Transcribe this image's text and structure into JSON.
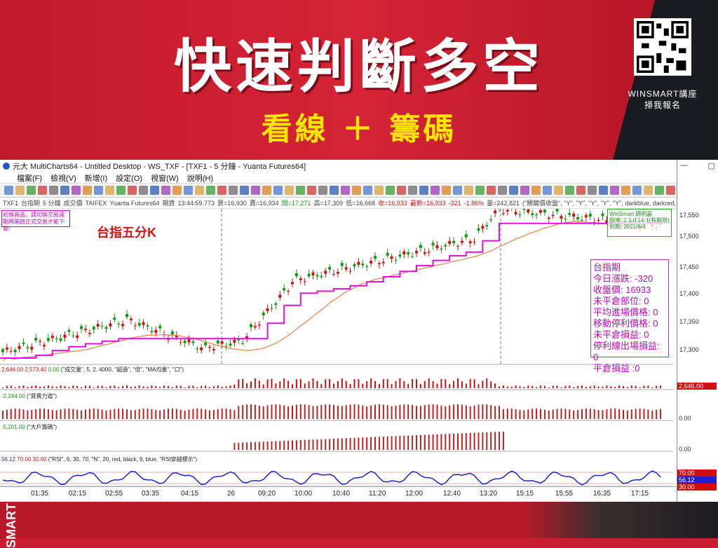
{
  "banner": {
    "title": "快速判斷多空",
    "subtitle": "看線 ＋ 籌碼",
    "qr_caption_1": "WINSMART講座",
    "qr_caption_2": "掃我報名"
  },
  "window": {
    "title": "元大 MultiCharts64 - Untitled Desktop - WS_TXF - [TXF1 - 5 分鐘 - Yuanta Futures64]",
    "controls": [
      "—",
      "▢",
      "✕"
    ]
  },
  "menu": [
    "檔案(F)",
    "檢視(V)",
    "新增(I)",
    "設定(O)",
    "視窗(W)",
    "說明(H)"
  ],
  "status": {
    "symbol": "TXF1",
    "name": "台指期",
    "interval": "5 分鐘",
    "field": "成交價",
    "exchange": "TAIFEX",
    "source": "Yuanta Futures64",
    "type": "期貨",
    "time": "13:44:59.773",
    "bid": "買=16,930",
    "ask": "賣=16,934",
    "open": "開=17,271",
    "high": "高=17,309",
    "low": "低=16,668",
    "close": "收=16,933",
    "last": "最新=16,933",
    "change": "-321",
    "change_pct": "-1.86%",
    "volume": "量=242,821",
    "indicator": "(\"關鍵價收盤\", \"Y\", \"Y\", \"Y\", \"Y\", \"Y\", darkblue, darkred, darkgreen,"
  },
  "chart": {
    "label": "台指五分K",
    "note": "初換商品，請切換交易週期再開啟正式交易才能下單!",
    "ws_line1": "WinSmart 聰明贏",
    "ws_line2": "版本: 1.1.0.14-1(有期限)",
    "ws_line3": "到期: 2021/6/4",
    "info": [
      "台指期",
      "今日漲跌: -320",
      "收盤價: 16933",
      "未平倉部位: 0",
      "平均進場價格: 0",
      "移動停利價格: 0",
      "未平倉損益: 0",
      "停利線出場損益: 0",
      "平倉損益 :0"
    ],
    "price_ticks": [
      "17,550",
      "17,500",
      "17,450",
      "17,400",
      "17,350",
      "17,300"
    ]
  },
  "panels": {
    "vol_label_a": "2,646.00",
    "vol_label_b": "2,573.40",
    "vol_label_c": "0.00",
    "vol_formula": "(\"成交量\", 5, 2, 4000, \"超過\", \"倍\", \"MA均量\", \"口\")",
    "vol_axis": "2,646.00",
    "buy_label": "-2,244.00",
    "buy_formula": "(\"買賣力道\")",
    "buy_axis": "0.00",
    "big_label": "-5,201.00",
    "big_formula": "(\"大戶籌碼\")",
    "big_axis": "0.00",
    "rsi_label_a": "56.12",
    "rsi_label_b": "70.00",
    "rsi_label_c": "30.00",
    "rsi_formula": "(\"RSI\", 6, 30, 70, \"N\", 20, red, black, 9, blue, \"RSI穿越標示\")",
    "rsi_70": "70.00",
    "rsi_val": "56.12",
    "rsi_30": "30.00"
  },
  "time_axis": [
    "01:35",
    "02:15",
    "02:55",
    "03:35",
    "04:15",
    "26",
    "09:20",
    "10:00",
    "10:40",
    "11:20",
    "12:00",
    "12:40",
    "13:20",
    "15:15",
    "15:55",
    "16:35",
    "17:15"
  ],
  "colors": {
    "banner_red": "#c91e2f",
    "title_yellow": "#ffe600",
    "candle_up": "#d01010",
    "candle_down": "#119911",
    "stop_line": "#e010e0",
    "ma_line": "#f08040",
    "rsi_line": "#2020d0"
  },
  "footer": {
    "side_text": "SMART"
  }
}
